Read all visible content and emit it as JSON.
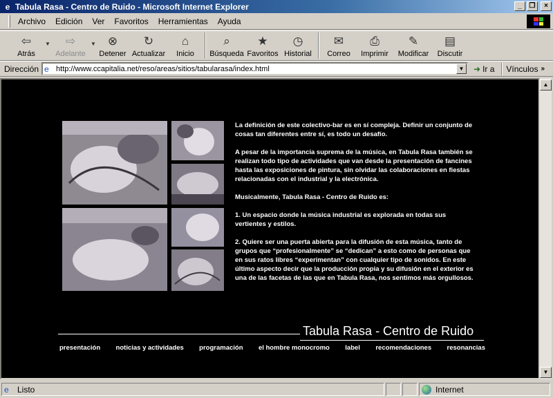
{
  "window": {
    "title": "Tabula Rasa - Centro de Ruido - Microsoft Internet Explorer",
    "buttons": {
      "minimize": "_",
      "restore": "❐",
      "close": "×"
    }
  },
  "menu": [
    "Archivo",
    "Edición",
    "Ver",
    "Favoritos",
    "Herramientas",
    "Ayuda"
  ],
  "toolbar": {
    "back": "Atrás",
    "forward": "Adelante",
    "stop": "Detener",
    "refresh": "Actualizar",
    "home": "Inicio",
    "search": "Búsqueda",
    "favorites": "Favoritos",
    "history": "Historial",
    "mail": "Correo",
    "print": "Imprimir",
    "edit": "Modificar",
    "discuss": "Discutir"
  },
  "address": {
    "label": "Dirección",
    "url": "http://www.ccapitalia.net/reso/areas/sitios/tabularasa/index.html",
    "go": "Ir a",
    "links": "Vínculos"
  },
  "page": {
    "paragraphs": [
      "La definición de este colectivo-bar es en sí compleja. Definir un conjunto de cosas tan diferentes entre sí, es todo un desafío.",
      "A pesar de la importancia suprema de la música, en Tabula Rasa también se realizan todo tipo de actividades que van desde la presentación de fancines hasta las exposiciones de pintura, sin olvidar las colaboraciones en fiestas relacionadas con el industrial y la electrónica.",
      "Musicalmente, Tabula Rasa - Centro de Ruido es:",
      "1. Un  espacio donde la música industrial es explorada en todas sus vertientes y estilos.",
      "2. Quiere ser una  puerta abierta para la difusión de esta música, tanto de grupos que “profesionalmente”  se  “dedican” a esto como de personas que en sus ratos libres “experimentan” con cualquier tipo de sonidos. En este último aspecto decir que la producción propia y su difusión en el exterior es una de las facetas de las que en Tabula Rasa, nos sentimos más orgullosos."
    ],
    "site_title": "Tabula Rasa - Centro de Ruido",
    "nav": [
      "presentación",
      "noticias y actividades",
      "programación",
      "el hombre monocromo",
      "label",
      "recomendaciones",
      "resonancias"
    ]
  },
  "status": {
    "text": "Listo",
    "zone": "Internet"
  }
}
